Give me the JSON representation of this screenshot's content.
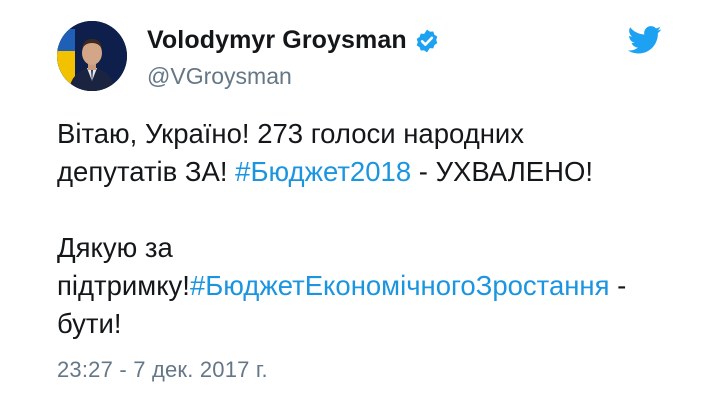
{
  "author": {
    "display_name": "Volodymyr Groysman",
    "handle": "@VGroysman",
    "verified": true,
    "avatar": "avatar-photo"
  },
  "tweet": {
    "line1": "Вітаю, Україно! 273 голоси народних",
    "line2_before": "депутатів ЗА! ",
    "hashtag_budget2018": "#Бюджет2018",
    "line2_after": " - УХВАЛЕНО!",
    "line4": "Дякую за",
    "line5_before": "підтримку!",
    "hashtag_budget_growth": "#БюджетЕкономічногоЗростання",
    "line5_after": " -",
    "line6": "бути!"
  },
  "timestamp": "23:27 - 7 дек. 2017 г.",
  "colors": {
    "text": "#14171a",
    "secondary": "#657786",
    "link": "#1b95e0",
    "twitter_blue": "#1da1f2"
  },
  "icons": {
    "verified": "verified-badge-icon",
    "brand": "twitter-bird-icon"
  }
}
